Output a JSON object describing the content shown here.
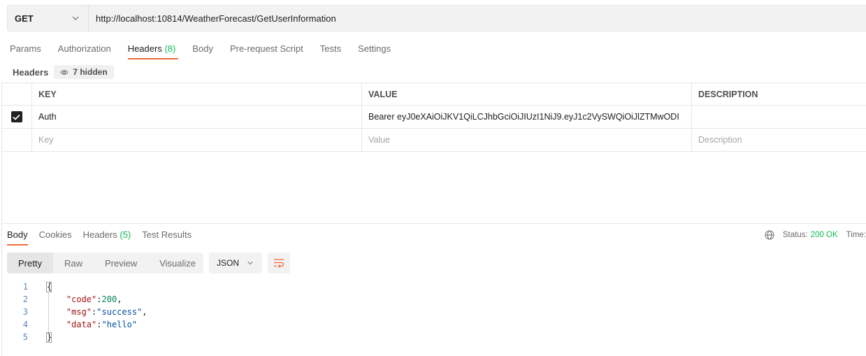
{
  "request": {
    "method": "GET",
    "url": "http://localhost:10814/WeatherForecast/GetUserInformation"
  },
  "request_tabs": [
    {
      "label": "Params",
      "count": ""
    },
    {
      "label": "Authorization",
      "count": ""
    },
    {
      "label": "Headers",
      "count": "(8)"
    },
    {
      "label": "Body",
      "count": ""
    },
    {
      "label": "Pre-request Script",
      "count": ""
    },
    {
      "label": "Tests",
      "count": ""
    },
    {
      "label": "Settings",
      "count": ""
    }
  ],
  "headers_section": {
    "title": "Headers",
    "hidden_label": "7 hidden"
  },
  "table": {
    "columns": [
      "KEY",
      "VALUE",
      "DESCRIPTION"
    ],
    "rows": [
      {
        "checked": true,
        "key": "Auth",
        "value": "Bearer eyJ0eXAiOiJKV1QiLCJhbGciOiJIUzI1NiJ9.eyJ1c2VySWQiOiJlZTMwODI",
        "description": ""
      }
    ],
    "placeholder": {
      "key": "Key",
      "value": "Value",
      "description": "Description"
    }
  },
  "response_tabs": [
    {
      "label": "Body",
      "count": ""
    },
    {
      "label": "Cookies",
      "count": ""
    },
    {
      "label": "Headers",
      "count": "(5)"
    },
    {
      "label": "Test Results",
      "count": ""
    }
  ],
  "status": {
    "label": "Status:",
    "code": "200 OK",
    "time_label": "Time:"
  },
  "view_modes": [
    "Pretty",
    "Raw",
    "Preview",
    "Visualize"
  ],
  "format": "JSON",
  "code_lines": [
    "1",
    "2",
    "3",
    "4",
    "5"
  ],
  "json_body": {
    "code_key": "\"code\"",
    "code_val": "200",
    "msg_key": "\"msg\"",
    "msg_val": "\"success\"",
    "data_key": "\"data\"",
    "data_val": "\"hello\""
  },
  "colors": {
    "accent": "#f26b3a",
    "success": "#0cbb52"
  }
}
